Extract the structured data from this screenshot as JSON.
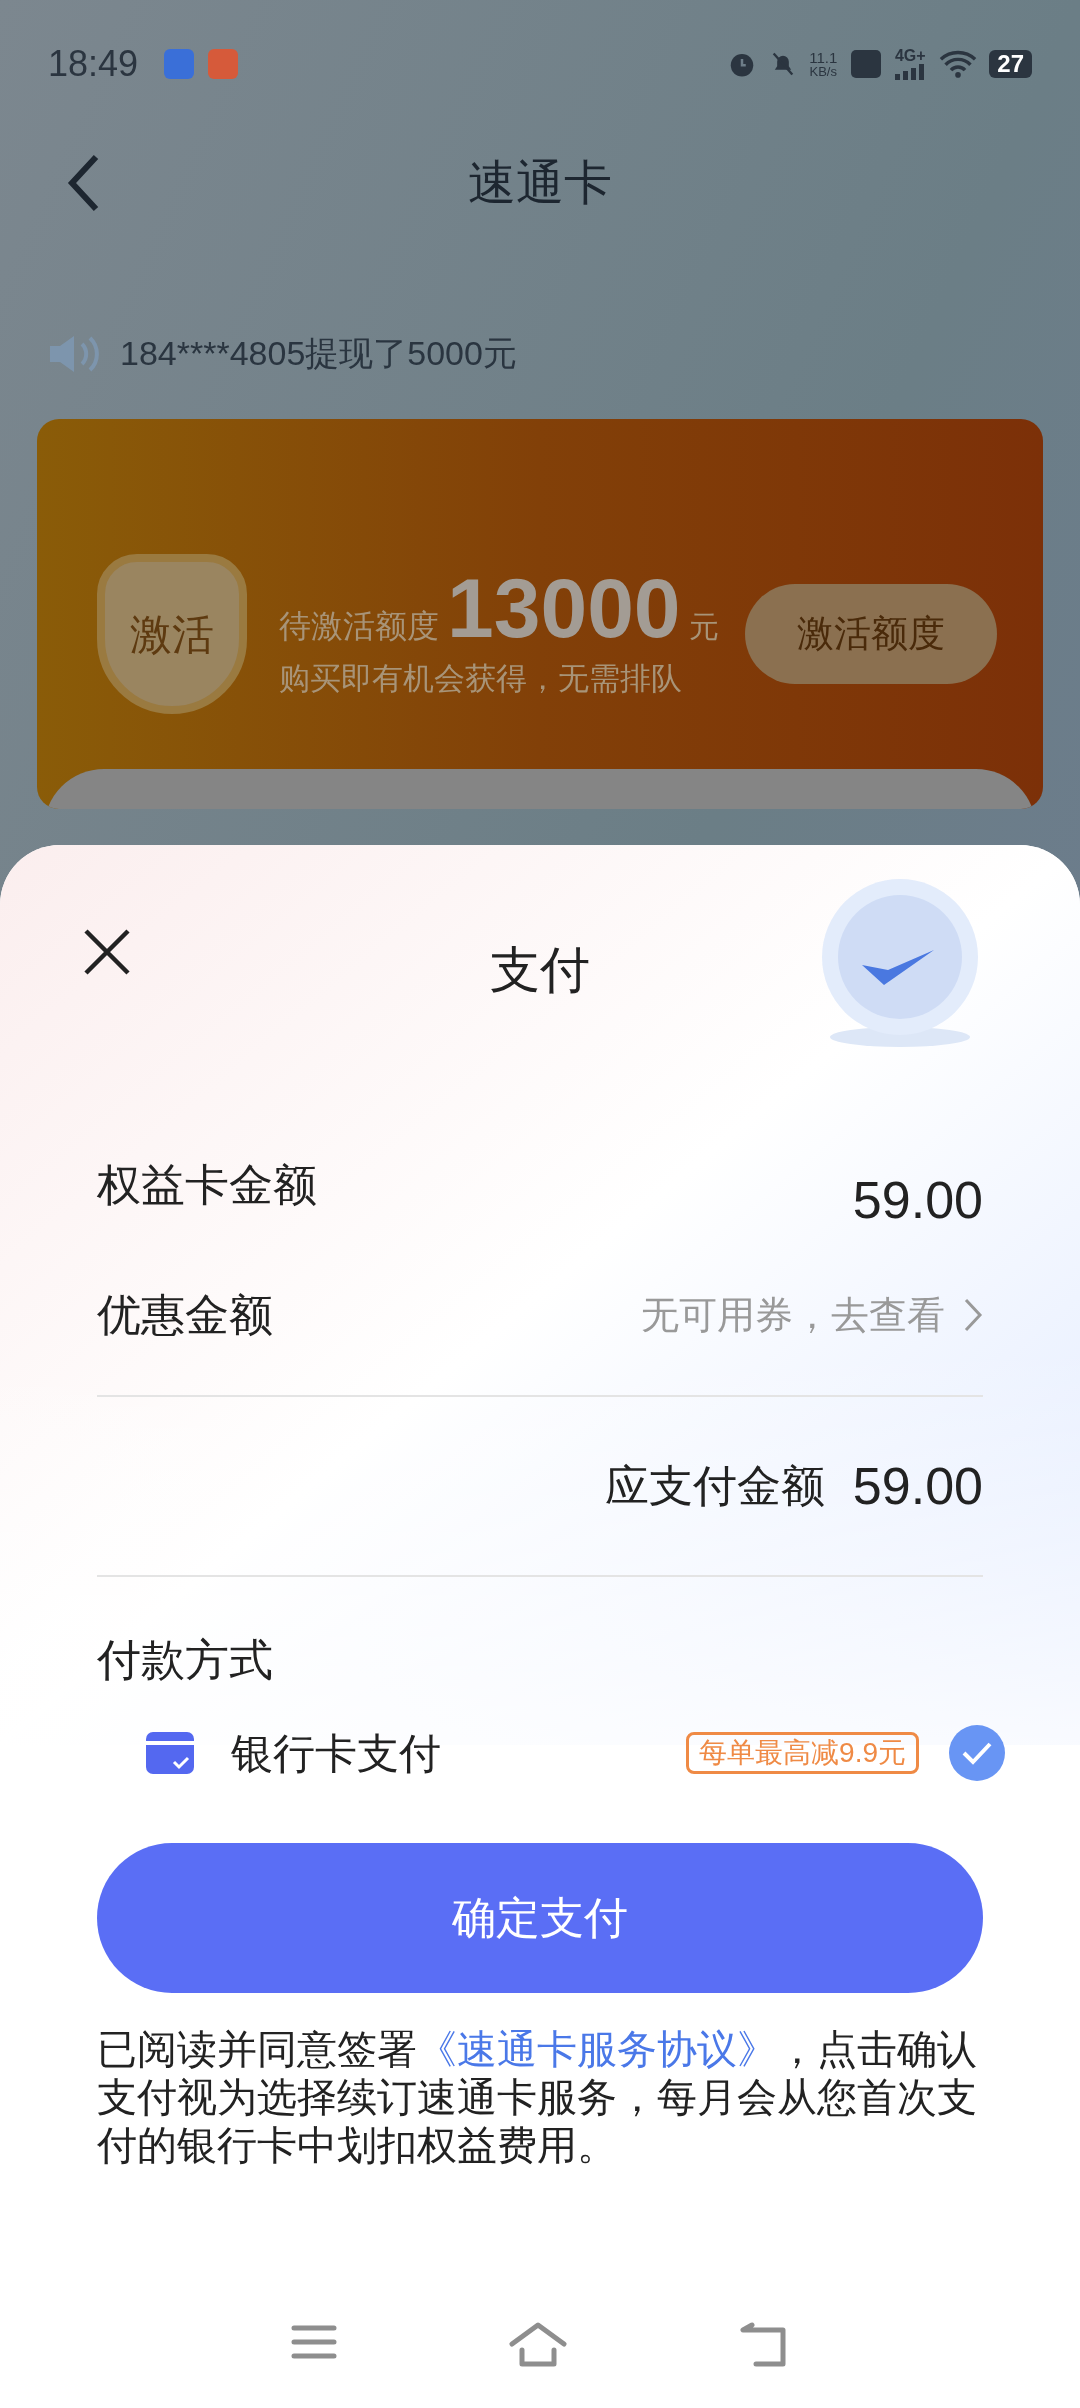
{
  "status_bar": {
    "time": "18:49",
    "net_speed": "11.1",
    "net_unit": "KB/s",
    "network": "4G+",
    "battery": "27"
  },
  "header": {
    "title": "速通卡"
  },
  "marquee": {
    "text": "184****4805提现了5000元"
  },
  "banner": {
    "shield_label": "激活",
    "label": "待激活额度",
    "amount": "13000",
    "unit": "元",
    "subtitle": "购买即有机会获得，无需排队",
    "button": "激活额度"
  },
  "sheet": {
    "title": "支付",
    "rows": [
      {
        "label": "权益卡金额",
        "value": "59.00",
        "kind": "amount"
      },
      {
        "label": "优惠金额",
        "value": "无可用券，去查看",
        "kind": "link"
      }
    ],
    "total": {
      "label": "应支付金额",
      "value": "59.00"
    },
    "payment_section": "付款方式",
    "methods": [
      {
        "label": "银行卡支付",
        "badge": "每单最高减9.9元",
        "selected": true
      }
    ],
    "confirm_button": "确定支付",
    "agreement": {
      "before": "已阅读并同意签署",
      "link": "《速通卡服务协议》",
      "after": "，点击确认支付视为选择续订速通卡服务，每月会从您首次支付的银行卡中划扣权益费用。"
    }
  }
}
